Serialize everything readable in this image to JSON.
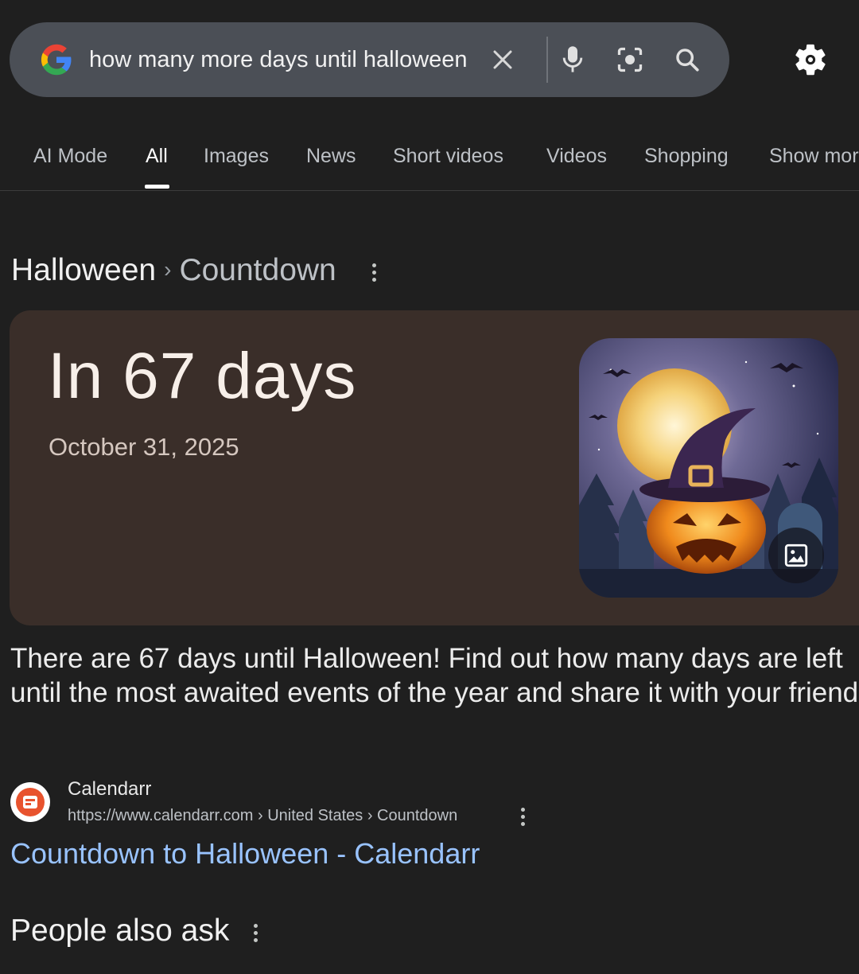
{
  "search": {
    "query": "how many more days until halloween",
    "icons": [
      "google-logo",
      "clear-icon",
      "microphone-icon",
      "lens-camera-icon",
      "search-icon",
      "settings-gear-icon"
    ]
  },
  "tabs": [
    {
      "label": "AI Mode",
      "active": false
    },
    {
      "label": "All",
      "active": true
    },
    {
      "label": "Images",
      "active": false
    },
    {
      "label": "News",
      "active": false
    },
    {
      "label": "Short videos",
      "active": false
    },
    {
      "label": "Videos",
      "active": false
    },
    {
      "label": "Shopping",
      "active": false
    },
    {
      "label": "Show mor",
      "active": false
    }
  ],
  "breadcrumb": {
    "parent": "Halloween",
    "separator": "›",
    "current": "Countdown"
  },
  "countdown": {
    "headline": "In 67 days",
    "date": "October 31, 2025",
    "image_icon": "image-icon",
    "card_color": "#3a2e29"
  },
  "description": "There are 67 days until Halloween! Find out how many days are left until the most awaited events of the year and share it with your friends!",
  "source": {
    "name": "Calendarr",
    "url": "https://www.calendarr.com › United States › Countdown",
    "brand_color": "#e8532e"
  },
  "result": {
    "title": "Countdown to Halloween - Calendarr",
    "link_color": "#99c3ff"
  },
  "people_also_ask": {
    "heading": "People also ask"
  }
}
